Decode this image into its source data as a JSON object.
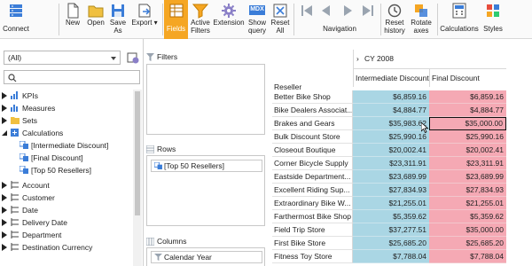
{
  "ribbon": {
    "connect": "Connect",
    "new": "New",
    "open": "Open",
    "save_as": "Save\nAs",
    "export": "Export",
    "fields": "Fields",
    "active_filters": "Active\nFilters",
    "extension": "Extension",
    "show_query": "Show\nquery",
    "reset_all": "Reset\nAll",
    "navigation": "Navigation",
    "reset_history": "Reset\nhistory",
    "rotate_axes": "Rotate\naxes",
    "calculations": "Calculations",
    "styles": "Styles",
    "mdx_badge": "MDX",
    "accent_color": "#f5a623"
  },
  "left_panel": {
    "combo_value": "(All)",
    "search_placeholder": "",
    "tree": [
      {
        "label": "KPIs",
        "icon": "kpi-icon",
        "level": 0
      },
      {
        "label": "Measures",
        "icon": "measures-icon",
        "level": 0
      },
      {
        "label": "Sets",
        "icon": "folder-icon",
        "level": 0
      },
      {
        "label": "Calculations",
        "icon": "calculations-icon",
        "level": 0
      },
      {
        "label": "[Intermediate Discount]",
        "icon": "calc-member-icon",
        "level": 1
      },
      {
        "label": "[Final Discount]",
        "icon": "calc-member-icon",
        "level": 1
      },
      {
        "label": "[Top 50 Resellers]",
        "icon": "calc-member-icon",
        "level": 1
      },
      {
        "label": "Account",
        "icon": "hierarchy-icon",
        "level": 0
      },
      {
        "label": "Customer",
        "icon": "hierarchy-icon",
        "level": 0
      },
      {
        "label": "Date",
        "icon": "hierarchy-icon",
        "level": 0
      },
      {
        "label": "Delivery Date",
        "icon": "hierarchy-icon",
        "level": 0
      },
      {
        "label": "Department",
        "icon": "hierarchy-icon",
        "level": 0
      },
      {
        "label": "Destination Currency",
        "icon": "hierarchy-icon",
        "level": 0
      }
    ]
  },
  "middle_panel": {
    "filters_title": "Filters",
    "rows_title": "Rows",
    "rows_chip": "[Top 50 Resellers]",
    "columns_title": "Columns",
    "columns_chip": "Calendar Year"
  },
  "pivot": {
    "year_header": "CY 2008",
    "row_header": "Reseller",
    "col1_header": "Intermediate Discount",
    "col2_header": "Final Discount",
    "col1_color": "#aad6e4",
    "col2_color": "#f5a9b4",
    "rows": [
      {
        "name": "Better Bike Shop",
        "intermediate": "$6,859.16",
        "final": "$6,859.16"
      },
      {
        "name": "Bike Dealers Associat...",
        "intermediate": "$4,884.77",
        "final": "$4,884.77"
      },
      {
        "name": "Brakes and Gears",
        "intermediate": "$35,983.62",
        "final": "$35,000.00"
      },
      {
        "name": "Bulk Discount Store",
        "intermediate": "$25,990.16",
        "final": "$25,990.16"
      },
      {
        "name": "Closeout Boutique",
        "intermediate": "$20,002.41",
        "final": "$20,002.41"
      },
      {
        "name": "Corner Bicycle Supply",
        "intermediate": "$23,311.91",
        "final": "$23,311.91"
      },
      {
        "name": "Eastside Department...",
        "intermediate": "$23,689.99",
        "final": "$23,689.99"
      },
      {
        "name": "Excellent Riding Sup...",
        "intermediate": "$27,834.93",
        "final": "$27,834.93"
      },
      {
        "name": "Extraordinary Bike W...",
        "intermediate": "$21,255.01",
        "final": "$21,255.01"
      },
      {
        "name": "Farthermost Bike Shop",
        "intermediate": "$5,359.62",
        "final": "$5,359.62"
      },
      {
        "name": "Field Trip Store",
        "intermediate": "$37,277.51",
        "final": "$35,000.00"
      },
      {
        "name": "First Bike Store",
        "intermediate": "$25,685.20",
        "final": "$25,685.20"
      },
      {
        "name": "Fitness Toy Store",
        "intermediate": "$7,788.04",
        "final": "$7,788.04"
      }
    ]
  }
}
